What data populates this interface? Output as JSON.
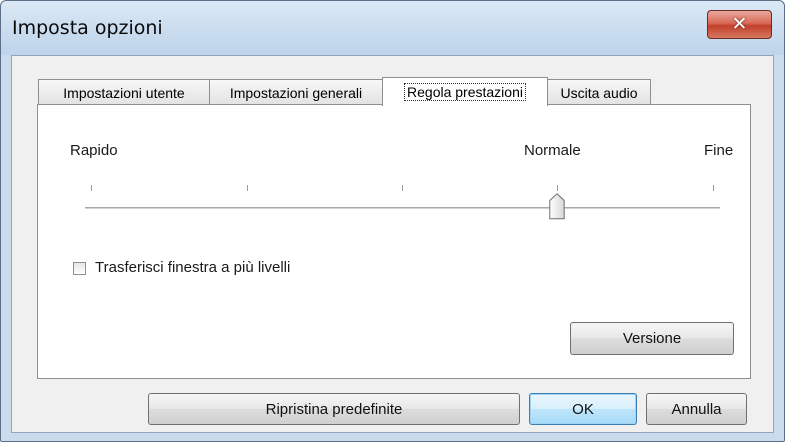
{
  "window": {
    "title": "Imposta opzioni",
    "close_glyph": "✕"
  },
  "tabs": [
    {
      "label": "Impostazioni utente",
      "active": false
    },
    {
      "label": "Impostazioni generali",
      "active": false
    },
    {
      "label": "Regola prestazioni",
      "active": true
    },
    {
      "label": "Uscita audio",
      "active": false
    }
  ],
  "performance": {
    "label_left": "Rapido",
    "label_mid": "Normale",
    "label_right": "Fine",
    "slider": {
      "value": 3,
      "min": 0,
      "max": 4
    }
  },
  "checkbox": {
    "label": "Trasferisci finestra a più livelli",
    "checked": false
  },
  "buttons": {
    "version": "Versione",
    "restore": "Ripristina predefinite",
    "ok": "OK",
    "cancel": "Annulla"
  }
}
